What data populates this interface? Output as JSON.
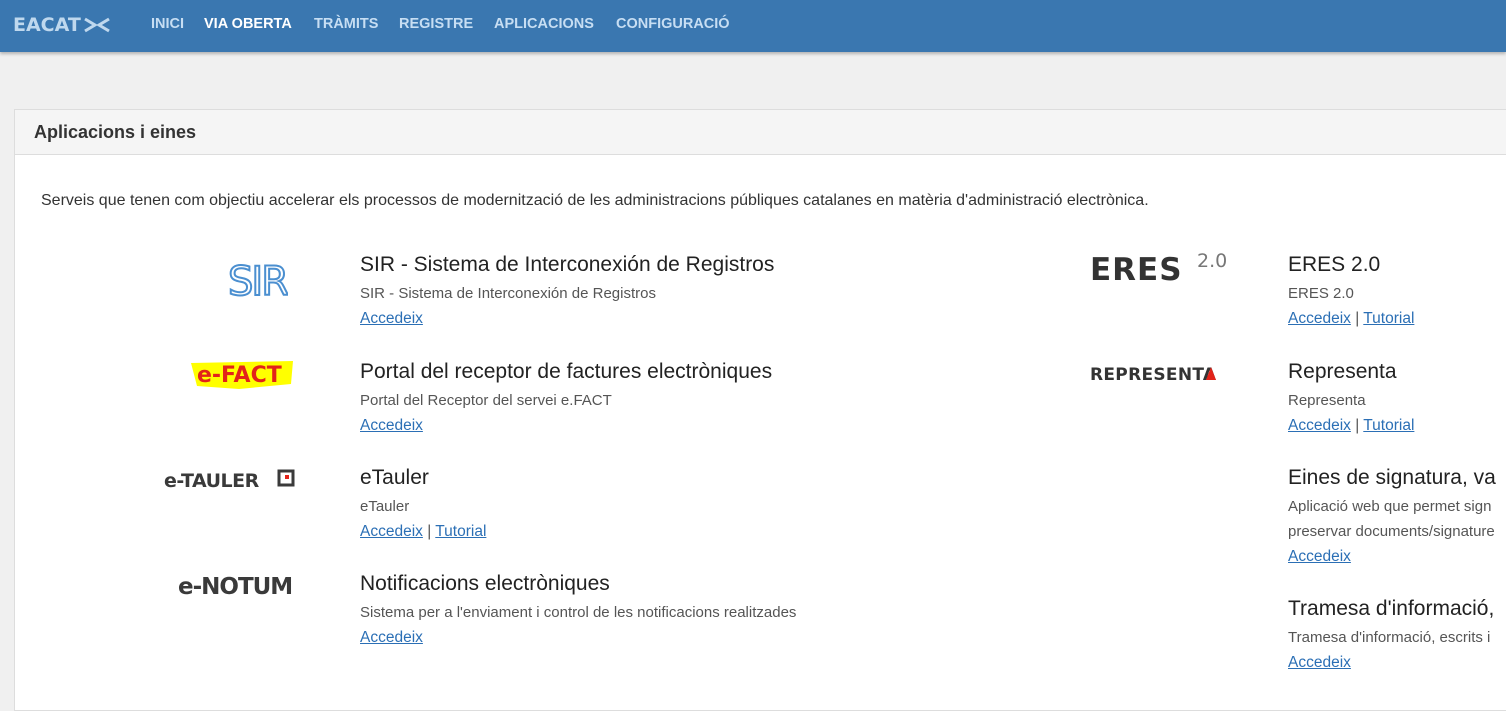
{
  "header": {
    "brand": "EACAT",
    "nav": [
      {
        "label": "INICI",
        "active": false
      },
      {
        "label": "VIA OBERTA",
        "active": true
      },
      {
        "label": "TRÀMITS",
        "active": false
      },
      {
        "label": "REGISTRE",
        "active": false
      },
      {
        "label": "APLICACIONS",
        "active": false
      },
      {
        "label": "CONFIGURACIÓ",
        "active": false
      }
    ]
  },
  "panel": {
    "title": "Aplicacions i eines",
    "intro": "Serveis que tenen com objectiu accelerar els processos de modernització de les administracions públiques catalanes en matèria d'administració electrònica."
  },
  "apps_left": [
    {
      "logo": "SIR",
      "title": "SIR - Sistema de Interconexión de Registros",
      "desc": "SIR - Sistema de Interconexión de Registros",
      "link1": "Accedeix"
    },
    {
      "logo": "e-FACT",
      "title": "Portal del receptor de factures electròniques",
      "desc": "Portal del Receptor del servei e.FACT",
      "link1": "Accedeix"
    },
    {
      "logo": "e-TAULER",
      "title": "eTauler",
      "desc": "eTauler",
      "link1": "Accedeix",
      "sep": "|",
      "link2": "Tutorial"
    },
    {
      "logo": "e-NOTUM",
      "title": "Notificacions electròniques",
      "desc": "Sistema per a l'enviament i control de les notificacions realitzades",
      "link1": "Accedeix"
    }
  ],
  "apps_right": [
    {
      "logo": "ERES",
      "logo_sup": "2.0",
      "title": "ERES 2.0",
      "desc": "ERES 2.0",
      "link1": "Accedeix",
      "sep": "|",
      "link2": "Tutorial"
    },
    {
      "logo": "REPRESENTA",
      "title": "Representa",
      "desc": "Representa",
      "link1": "Accedeix",
      "sep": "|",
      "link2": "Tutorial"
    },
    {
      "title": "Eines de signatura, va",
      "desc": "Aplicació web que permet sign",
      "desc2": "preservar documents/signature",
      "link1": "Accedeix"
    },
    {
      "title": "Tramesa d'informació,",
      "desc": "Tramesa d'informació, escrits i",
      "link1": "Accedeix"
    }
  ],
  "colors": {
    "topbar": "#3a77b0",
    "link": "#2b6fb5",
    "efact_highlight": "#ffff00",
    "accent_red": "#e2231a"
  }
}
